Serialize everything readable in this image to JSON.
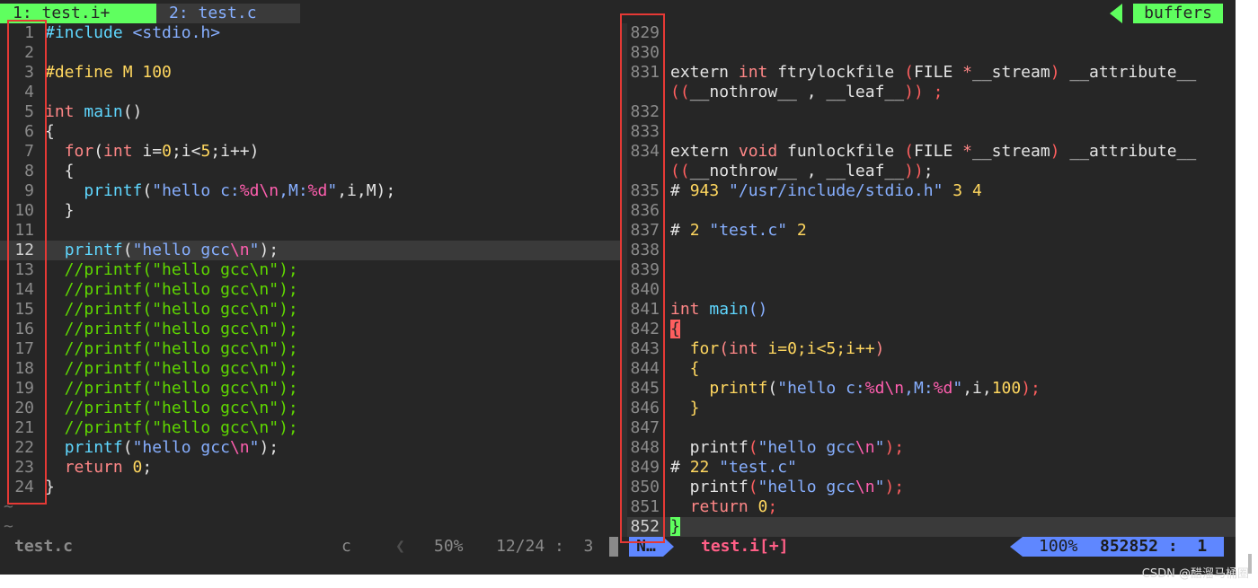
{
  "tabs": [
    {
      "label": "1: test.i+"
    },
    {
      "label": "2: test.c"
    }
  ],
  "buffers_label": "buffers",
  "left_pane": {
    "lines": [
      {
        "n": "1",
        "segs": [
          [
            "inc",
            "#include "
          ],
          [
            "str",
            "<stdio.h>"
          ]
        ]
      },
      {
        "n": "2",
        "segs": []
      },
      {
        "n": "3",
        "segs": [
          [
            "def",
            "#define M 100"
          ]
        ]
      },
      {
        "n": "4",
        "segs": []
      },
      {
        "n": "5",
        "segs": [
          [
            "typ",
            "int "
          ],
          [
            "fn",
            "main"
          ],
          [
            "plain",
            "()"
          ]
        ]
      },
      {
        "n": "6",
        "segs": [
          [
            "plain",
            "{"
          ]
        ]
      },
      {
        "n": "7",
        "segs": [
          [
            "plain",
            "  "
          ],
          [
            "kw",
            "for"
          ],
          [
            "plain",
            "("
          ],
          [
            "typ",
            "int "
          ],
          [
            "plain",
            "i="
          ],
          [
            "num",
            "0"
          ],
          [
            "plain",
            ";i<"
          ],
          [
            "num",
            "5"
          ],
          [
            "plain",
            ";i++)"
          ]
        ]
      },
      {
        "n": "8",
        "segs": [
          [
            "plain",
            "  {"
          ]
        ]
      },
      {
        "n": "9",
        "segs": [
          [
            "plain",
            "    "
          ],
          [
            "fn",
            "printf"
          ],
          [
            "plain",
            "("
          ],
          [
            "str",
            "\"hello c:"
          ],
          [
            "esc",
            "%d\\n"
          ],
          [
            "str",
            ",M:"
          ],
          [
            "esc",
            "%d"
          ],
          [
            "str",
            "\""
          ],
          [
            "plain",
            ",i,M);"
          ]
        ]
      },
      {
        "n": "10",
        "segs": [
          [
            "plain",
            "  }"
          ]
        ]
      },
      {
        "n": "11",
        "segs": []
      },
      {
        "n": "12",
        "segs": [
          [
            "plain",
            "  "
          ],
          [
            "fn",
            "printf"
          ],
          [
            "plain",
            "("
          ],
          [
            "str",
            "\"hello gcc"
          ],
          [
            "esc",
            "\\n"
          ],
          [
            "str",
            "\""
          ],
          [
            "plain",
            ");"
          ]
        ],
        "cursor": true
      },
      {
        "n": "13",
        "segs": [
          [
            "cmt",
            "  //printf(\"hello gcc\\n\");"
          ]
        ]
      },
      {
        "n": "14",
        "segs": [
          [
            "cmt",
            "  //printf(\"hello gcc\\n\");"
          ]
        ]
      },
      {
        "n": "15",
        "segs": [
          [
            "cmt",
            "  //printf(\"hello gcc\\n\");"
          ]
        ]
      },
      {
        "n": "16",
        "segs": [
          [
            "cmt",
            "  //printf(\"hello gcc\\n\");"
          ]
        ]
      },
      {
        "n": "17",
        "segs": [
          [
            "cmt",
            "  //printf(\"hello gcc\\n\");"
          ]
        ]
      },
      {
        "n": "18",
        "segs": [
          [
            "cmt",
            "  //printf(\"hello gcc\\n\");"
          ]
        ]
      },
      {
        "n": "19",
        "segs": [
          [
            "cmt",
            "  //printf(\"hello gcc\\n\");"
          ]
        ]
      },
      {
        "n": "20",
        "segs": [
          [
            "cmt",
            "  //printf(\"hello gcc\\n\");"
          ]
        ]
      },
      {
        "n": "21",
        "segs": [
          [
            "cmt",
            "  //printf(\"hello gcc\\n\");"
          ]
        ]
      },
      {
        "n": "22",
        "segs": [
          [
            "plain",
            "  "
          ],
          [
            "fn",
            "printf"
          ],
          [
            "plain",
            "("
          ],
          [
            "str",
            "\"hello gcc"
          ],
          [
            "esc",
            "\\n"
          ],
          [
            "str",
            "\""
          ],
          [
            "plain",
            ");"
          ]
        ]
      },
      {
        "n": "23",
        "segs": [
          [
            "plain",
            "  "
          ],
          [
            "kw",
            "return "
          ],
          [
            "num",
            "0"
          ],
          [
            "plain",
            ";"
          ]
        ]
      },
      {
        "n": "24",
        "segs": [
          [
            "plain",
            "}"
          ]
        ]
      },
      {
        "n": "~",
        "segs": [],
        "tilde": true
      },
      {
        "n": "~",
        "segs": [],
        "tilde": true
      }
    ]
  },
  "right_pane": {
    "lines": [
      {
        "n": "829",
        "segs": []
      },
      {
        "n": "830",
        "segs": []
      },
      {
        "n": "831",
        "segs": [
          [
            "plain",
            "extern "
          ],
          [
            "typ",
            "int "
          ],
          [
            "plain",
            "ftrylockfile "
          ],
          [
            "paren",
            "("
          ],
          [
            "plain",
            "FILE "
          ],
          [
            "kw",
            "*"
          ],
          [
            "plain",
            "__stream"
          ],
          [
            "paren",
            ")"
          ],
          [
            "plain",
            " __attribute__"
          ]
        ]
      },
      {
        "n": "",
        "segs": [
          [
            "paren",
            "(("
          ],
          [
            "plain",
            "__nothrow__ , __leaf__"
          ],
          [
            "paren",
            ")) ;"
          ]
        ]
      },
      {
        "n": "832",
        "segs": []
      },
      {
        "n": "833",
        "segs": []
      },
      {
        "n": "834",
        "segs": [
          [
            "plain",
            "extern "
          ],
          [
            "typ",
            "void "
          ],
          [
            "plain",
            "funlockfile "
          ],
          [
            "paren",
            "("
          ],
          [
            "plain",
            "FILE "
          ],
          [
            "kw",
            "*"
          ],
          [
            "plain",
            "__stream"
          ],
          [
            "paren",
            ")"
          ],
          [
            "plain",
            " __attribute__"
          ]
        ]
      },
      {
        "n": "",
        "segs": [
          [
            "paren",
            "(("
          ],
          [
            "plain",
            "__nothrow__ , __leaf__"
          ],
          [
            "paren",
            "))"
          ],
          [
            "plain",
            ";"
          ]
        ]
      },
      {
        "n": "835",
        "segs": [
          [
            "plain",
            "# "
          ],
          [
            "num",
            "943 "
          ],
          [
            "str",
            "\"/usr/include/stdio.h\" "
          ],
          [
            "num",
            "3 4"
          ]
        ]
      },
      {
        "n": "836",
        "segs": []
      },
      {
        "n": "837",
        "segs": [
          [
            "plain",
            "# "
          ],
          [
            "num",
            "2 "
          ],
          [
            "str",
            "\"test.c\" "
          ],
          [
            "num",
            "2"
          ]
        ]
      },
      {
        "n": "838",
        "segs": []
      },
      {
        "n": "839",
        "segs": []
      },
      {
        "n": "840",
        "segs": []
      },
      {
        "n": "841",
        "segs": [
          [
            "typ",
            "int "
          ],
          [
            "fn",
            "main"
          ],
          [
            "str",
            "()"
          ]
        ]
      },
      {
        "n": "842",
        "segs": [
          [
            "braceL",
            "{"
          ]
        ]
      },
      {
        "n": "843",
        "segs": [
          [
            "plain",
            "  "
          ],
          [
            "def",
            "for"
          ],
          [
            "kw",
            "("
          ],
          [
            "typ",
            "int "
          ],
          [
            "def",
            "i=0;i<5;i++"
          ],
          [
            "kw",
            ")"
          ]
        ]
      },
      {
        "n": "844",
        "segs": [
          [
            "def",
            "  {"
          ]
        ]
      },
      {
        "n": "845",
        "segs": [
          [
            "plain",
            "    "
          ],
          [
            "def",
            "printf"
          ],
          [
            "plain",
            "("
          ],
          [
            "str",
            "\"hello c:"
          ],
          [
            "esc",
            "%d\\n"
          ],
          [
            "str",
            ",M:"
          ],
          [
            "esc",
            "%d"
          ],
          [
            "str",
            "\""
          ],
          [
            "plain",
            ",i,"
          ],
          [
            "num",
            "100"
          ],
          [
            "paren",
            ");"
          ]
        ]
      },
      {
        "n": "846",
        "segs": [
          [
            "def",
            "  }"
          ]
        ]
      },
      {
        "n": "847",
        "segs": []
      },
      {
        "n": "848",
        "segs": [
          [
            "plain",
            "  printf"
          ],
          [
            "paren",
            "("
          ],
          [
            "str",
            "\"hello gcc"
          ],
          [
            "esc",
            "\\n"
          ],
          [
            "str",
            "\""
          ],
          [
            "paren",
            ");"
          ]
        ]
      },
      {
        "n": "849",
        "segs": [
          [
            "plain",
            "# "
          ],
          [
            "num",
            "22 "
          ],
          [
            "str",
            "\"test.c\""
          ]
        ]
      },
      {
        "n": "850",
        "segs": [
          [
            "plain",
            "  printf"
          ],
          [
            "paren",
            "("
          ],
          [
            "str",
            "\"hello gcc"
          ],
          [
            "esc",
            "\\n"
          ],
          [
            "str",
            "\""
          ],
          [
            "paren",
            ");"
          ]
        ]
      },
      {
        "n": "851",
        "segs": [
          [
            "plain",
            "  "
          ],
          [
            "kw",
            "return "
          ],
          [
            "num",
            "0"
          ],
          [
            "paren",
            ";"
          ]
        ]
      },
      {
        "n": "852",
        "segs": [
          [
            "braceR",
            "}"
          ]
        ],
        "cursor": true
      }
    ]
  },
  "left_status": {
    "filename": "test.c",
    "filetype": "c",
    "percent": "50%",
    "position": "12/24 :  3"
  },
  "right_status": {
    "mode": "N…",
    "filename": "test.i[+]",
    "percent": "100%",
    "position": "852852 :  1"
  },
  "watermark": "CSDN @醋溜马桶圈",
  "colors": {
    "background": "#262626",
    "tab_active": "#5fff5f",
    "comment": "#5fd700",
    "highlight_box": "#e53935"
  }
}
